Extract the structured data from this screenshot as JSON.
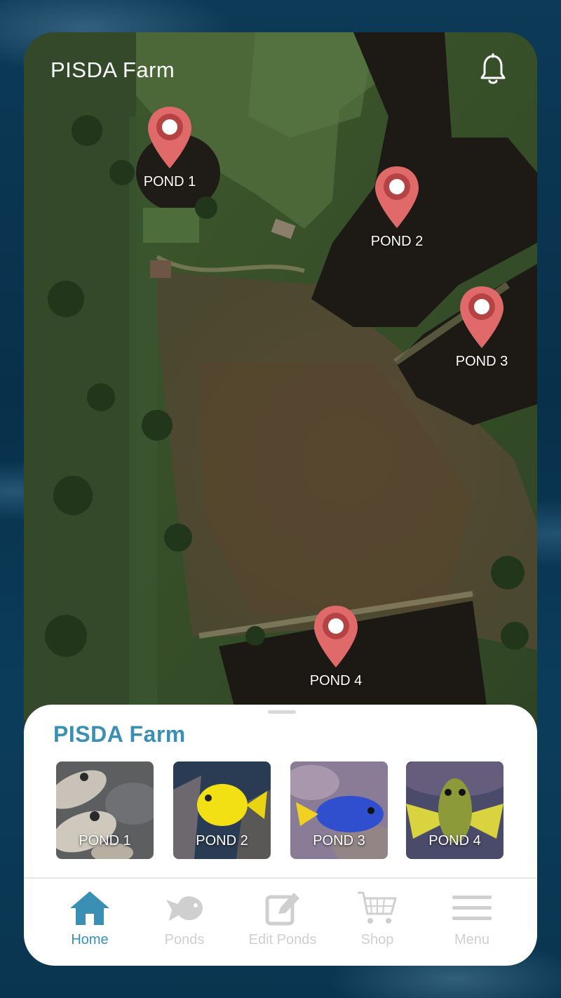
{
  "header": {
    "title": "PISDA Farm",
    "bell_icon": "bell-icon"
  },
  "map": {
    "pins": [
      {
        "label": "POND 1"
      },
      {
        "label": "POND 2"
      },
      {
        "label": "POND 3"
      },
      {
        "label": "POND 4"
      }
    ],
    "pin_color": "#e06a6a",
    "pin_icon": "location-pin-icon"
  },
  "sheet": {
    "title": "PISDA Farm",
    "title_color": "#3a8fb5",
    "ponds": [
      {
        "label": "POND 1",
        "image": "silver-fish-on-stone"
      },
      {
        "label": "POND 2",
        "image": "yellow-tang-fish"
      },
      {
        "label": "POND 3",
        "image": "blue-damselfish"
      },
      {
        "label": "POND 4",
        "image": "yellow-finned-fish"
      }
    ]
  },
  "nav": {
    "items": [
      {
        "label": "Home",
        "icon": "home-icon",
        "active": true
      },
      {
        "label": "Ponds",
        "icon": "fish-icon",
        "active": false
      },
      {
        "label": "Edit Ponds",
        "icon": "edit-icon",
        "active": false
      },
      {
        "label": "Shop",
        "icon": "cart-icon",
        "active": false
      },
      {
        "label": "Menu",
        "icon": "menu-icon",
        "active": false
      }
    ],
    "active_color": "#3a8fb5",
    "inactive_color": "#cfcfcf"
  }
}
